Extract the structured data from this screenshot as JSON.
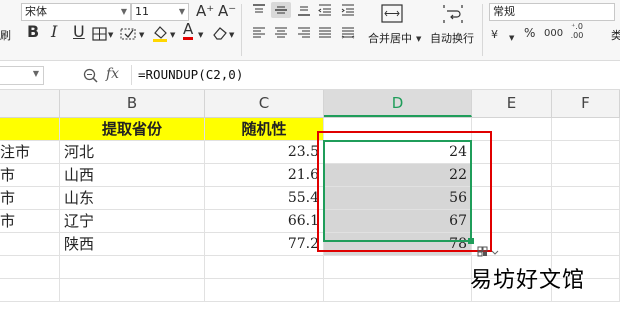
{
  "ribbon": {
    "font_name": "宋体",
    "font_size": "11",
    "grow_font": "A⁺",
    "shrink_font": "A⁻",
    "number_format": "常规",
    "merge_center": "合并居中",
    "wrap_text": "自动换行",
    "left_edge_label": "刷",
    "right_edge_label": "类",
    "bold": "B",
    "italic": "I",
    "underline": "U",
    "percent": "%",
    "thousands": "000",
    "decimal_inc": "⁺.0 .00",
    "decimal_dec": "⁺.00 .0"
  },
  "formula_bar": {
    "fx_label": "fx",
    "formula": "=ROUNDUP(C2,0)"
  },
  "columns": [
    "B",
    "C",
    "D",
    "E",
    "F"
  ],
  "header_row": {
    "col_b": "提取省份",
    "col_c": "随机性"
  },
  "rows": [
    {
      "a": "注市",
      "b": "河北",
      "c": "23.5",
      "d": "24"
    },
    {
      "a": "市",
      "b": "山西",
      "c": "21.6",
      "d": "22"
    },
    {
      "a": "市",
      "b": "山东",
      "c": "55.4",
      "d": "56"
    },
    {
      "a": "市",
      "b": "辽宁",
      "c": "66.1",
      "d": "67"
    },
    {
      "a": "",
      "b": "陕西",
      "c": "77.2",
      "d": "78"
    }
  ],
  "watermark": "易坊好文馆",
  "colors": {
    "header_yellow": "#ffff00",
    "selection_fill": "#d6d6d6",
    "selection_border": "#1f9d5a",
    "highlight_box": "#e00000",
    "col_d_header": "#dcdcdc",
    "col_d_text": "#1f9d5a"
  }
}
